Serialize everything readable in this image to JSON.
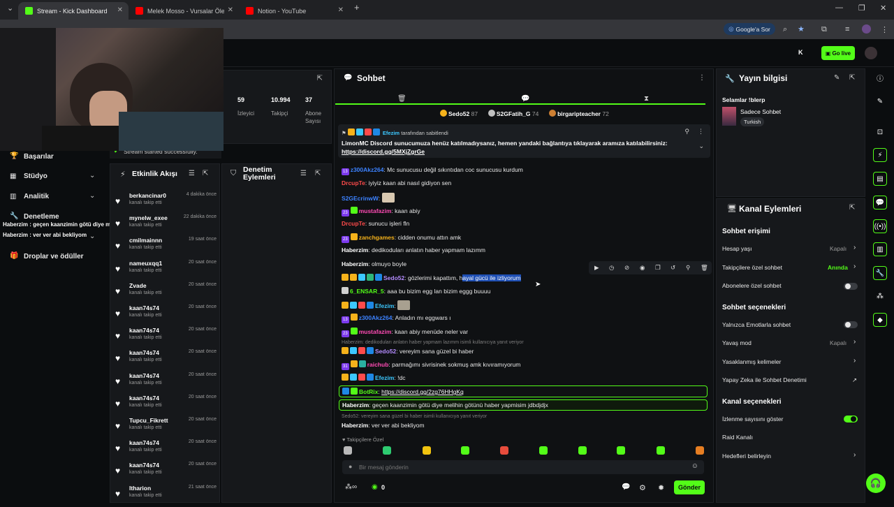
{
  "browser": {
    "tabs": [
      {
        "title": "Stream - Kick Dashboard"
      },
      {
        "title": "Melek Mosso - Vursalar Ölemem"
      },
      {
        "title": "Notion - YouTube"
      }
    ],
    "google_button": "Google'a Sor"
  },
  "topbar": {
    "go_live_label": "Go live"
  },
  "sidebar": {
    "toast": "Stream started successfully.",
    "items": [
      {
        "label": "Başarılar"
      },
      {
        "label": "Stüdyo"
      },
      {
        "label": "Analitik"
      },
      {
        "label": "Denetleme"
      },
      {
        "label": "Droplar ve ödüller"
      }
    ]
  },
  "overlay_chat": [
    "Haberzim : geçen kaanzimin götü diye melihin götünü haber yapmisim jdbdjdjx",
    "Haberzim : ver ver abi bekliyom"
  ],
  "stats": [
    {
      "value": "59",
      "label": "İzleyici"
    },
    {
      "value": "10.994",
      "label": "Takipçi"
    },
    {
      "value": "37",
      "label": "Abone Sayısı"
    }
  ],
  "activity": {
    "title": "Etkinlik Akışı",
    "items": [
      {
        "name": "berkancinar0",
        "sub": "kanalı takip etti",
        "time": "4 dakika önce"
      },
      {
        "name": "mynelw_exee",
        "sub": "kanalı takip etti",
        "time": "22 dakika önce"
      },
      {
        "name": "cmilmainnn",
        "sub": "kanalı takip etti",
        "time": "19 saat önce"
      },
      {
        "name": "nameuxqq1",
        "sub": "kanalı takip etti",
        "time": "20 saat önce"
      },
      {
        "name": "Zvade",
        "sub": "kanalı takip etti",
        "time": "20 saat önce"
      },
      {
        "name": "kaan74s74",
        "sub": "kanalı takip etti",
        "time": "20 saat önce"
      },
      {
        "name": "kaan74s74",
        "sub": "kanalı takip etti",
        "time": "20 saat önce"
      },
      {
        "name": "kaan74s74",
        "sub": "kanalı takip etti",
        "time": "20 saat önce"
      },
      {
        "name": "kaan74s74",
        "sub": "kanalı takip etti",
        "time": "20 saat önce"
      },
      {
        "name": "kaan74s74",
        "sub": "kanalı takip etti",
        "time": "20 saat önce"
      },
      {
        "name": "Tupcu_Fikrett",
        "sub": "kanalı takip etti",
        "time": "20 saat önce"
      },
      {
        "name": "kaan74s74",
        "sub": "kanalı takip etti",
        "time": "20 saat önce"
      },
      {
        "name": "kaan74s74",
        "sub": "kanalı takip etti",
        "time": "20 saat önce"
      },
      {
        "name": "Itharion",
        "sub": "kanalı takip etti",
        "time": "21 saat önce"
      }
    ]
  },
  "moderation": {
    "title": "Denetim Eylemleri"
  },
  "chat": {
    "title": "Sohbet",
    "leaders": [
      {
        "name": "Sedo52",
        "count": "87",
        "color": "#f5b21b"
      },
      {
        "name": "S2GFatih_G",
        "count": "74",
        "color": "#c0c0c0"
      },
      {
        "name": "birgaripteacher",
        "count": "72",
        "color": "#cd7f32"
      }
    ],
    "pinned": {
      "by": "Efezim",
      "by_suffix": "tarafından sabitlendi",
      "text": "LimonMC Discord sunucumuza henüz katılmadıysanız, hemen yandaki bağlantıya tıklayarak aramıza katılabilirsiniz:",
      "link": "https://discord.gg/5MXjZgrGe"
    },
    "messages": [
      {
        "user": "z300Akz264",
        "color": "#3c82ff",
        "text": ": Mc sunucusu değil sıkıntıdan coc sunucusu kurdum",
        "sub": "13"
      },
      {
        "user": "DrcupTe",
        "color": "#ff4b4b",
        "text": ": iyiyiz kaan abi nasıl gidiyon sen"
      },
      {
        "user": "S2GEcrinwW",
        "color": "#3c82ff",
        "text": ":"
      },
      {
        "user": "mustafazim",
        "color": "#ff4bb4",
        "text": ": kaan abiy",
        "sub": "23"
      },
      {
        "user": "DrcupTe",
        "color": "#ff4b4b",
        "text": ": sunucu işleri fln"
      },
      {
        "user": "zanchgames",
        "color": "#f5b21b",
        "text": ": cidden onumu attın amk",
        "sub": "23"
      },
      {
        "user": "Haberzim",
        "color": "#ffffff",
        "text": ": dedikoduları anlatın haber yapmam lazımm"
      },
      {
        "user": "Haberzim",
        "color": "#ffffff",
        "text": ": olmuyo boyle"
      },
      {
        "user": "Sedo52",
        "color": "#b48cff",
        "text_a": ": gözlerimi kapattım, h",
        "text_sel": "ayal gücü ile izliyorum"
      },
      {
        "user": "6_ENSAR_5",
        "color": "#53fc18",
        "text": ": aaa bu bizim egg lan bizim eggg buuuu"
      },
      {
        "user": "Efezim",
        "color": "#3cc8ff",
        "text": ":"
      },
      {
        "user": "z300Akz264",
        "color": "#3c82ff",
        "text": ": Anladın mı eggwars ı",
        "sub": "13"
      },
      {
        "user": "mustafazim",
        "color": "#ff4bb4",
        "text": ": kaan abiy menüde neler var",
        "sub": "23"
      },
      {
        "user": "Sedo52",
        "color": "#b48cff",
        "text": ": vereyim sana güzel bi haber"
      },
      {
        "user": "raichub",
        "color": "#ff4bb4",
        "text": ": parmağımı sivrisinek sokmuş amk kıvıramıyorum",
        "sub": "31"
      },
      {
        "user": "Efezim",
        "color": "#3cc8ff",
        "text": ": !dc"
      },
      {
        "user": "BotRix",
        "color": "#53fc18",
        "text": ": ",
        "link": "https://discord.gg/2zg76HHgKq"
      },
      {
        "user": "Haberzim",
        "color": "#ffffff",
        "text": ": geçen kaanzimin götü diye melihin götünü haber yapmisim jdbdjdjx"
      },
      {
        "user": "Haberzim",
        "color": "#ffffff",
        "text": ": ver ver abi bekliyom"
      }
    ],
    "reply_1": "Haberzim: dedikoduları anlatın haber yapmam lazımm isimli kullanıcıya yanıt veriyor",
    "reply_2": "Sedo52: vereyim sana güzel bi haber isimli kullanıcıya yanıt veriyor",
    "followers_only": "Takipçilere Özel",
    "input_placeholder": "Bir mesaj gönderin",
    "points": "0",
    "send_label": "Gönder"
  },
  "stream_info": {
    "title": "Yayın bilgisi",
    "stream_title": "Selamlar !blerp",
    "category": "Sadece Sohbet",
    "tag": "Turkish"
  },
  "channel_actions": {
    "title": "Kanal Eylemleri",
    "chat_access": "Sohbet erişimi",
    "account_age": "Hesap yaşı",
    "account_age_value": "Kapalı",
    "followers_only": "Takipçilere özel sohbet",
    "followers_only_value": "Anında",
    "subscribers_only": "Abonelere özel sohbet",
    "chat_options": "Sohbet seçenekleri",
    "emotes_only": "Yalnızca Emotlarla sohbet",
    "slow_mode": "Yavaş mod",
    "slow_mode_value": "Kapalı",
    "banned_words": "Yasaklanmış kelimeler",
    "ai_moderation": "Yapay Zeka ile Sohbet Denetimi",
    "channel_options": "Kanal seçenekleri",
    "show_viewers": "İzlenme sayısını göster",
    "raid": "Raid Kanalı",
    "goals": "Hedefleri belirleyin"
  },
  "colors": {
    "accent": "#53fc18",
    "panel": "#16181b",
    "bg": "#0b0d0f"
  }
}
